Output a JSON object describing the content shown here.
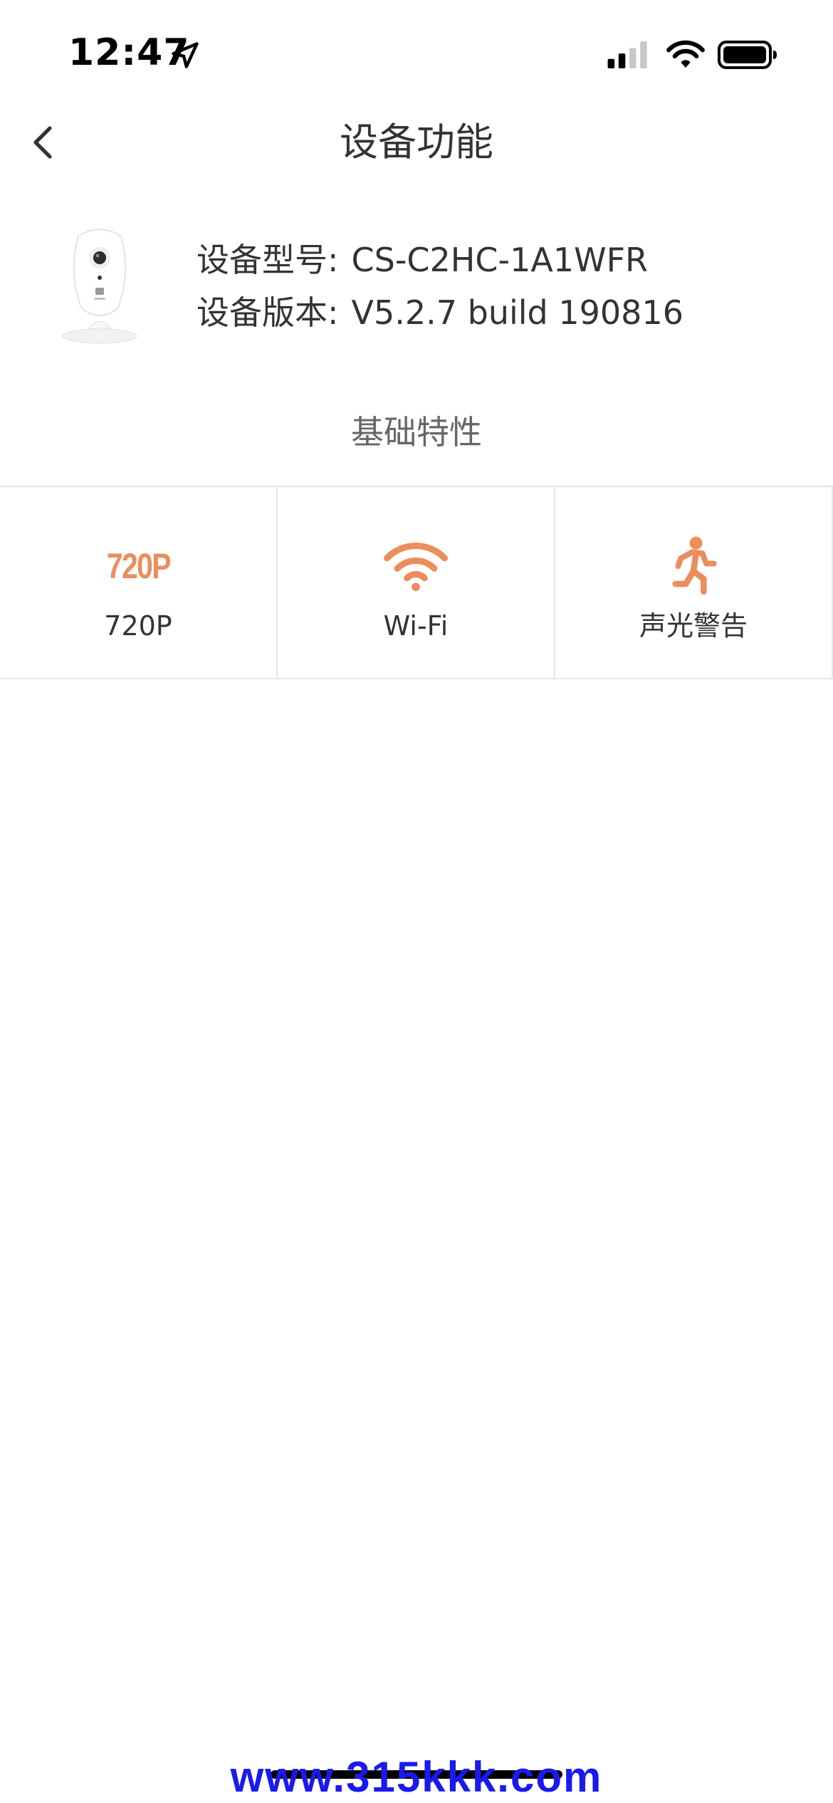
{
  "status_bar": {
    "time": "12:47",
    "icons": [
      "location-arrow-icon",
      "cellular-signal-icon",
      "wifi-icon",
      "battery-icon"
    ]
  },
  "nav": {
    "back_icon": "chevron-left-icon",
    "title": "设备功能"
  },
  "device": {
    "image_icon": "camera-device-icon",
    "model_label": "设备型号:",
    "model_value": "CS-C2HC-1A1WFR",
    "version_label": "设备版本:",
    "version_value": "V5.2.7 build 190816"
  },
  "section": {
    "title": "基础特性"
  },
  "features": [
    {
      "icon": "resolution-720p-icon",
      "icon_text": "720P",
      "label": "720P"
    },
    {
      "icon": "wifi-icon",
      "label": "Wi-Fi"
    },
    {
      "icon": "running-person-icon",
      "label": "声光警告"
    }
  ],
  "watermark": "www.315kkk.com",
  "colors": {
    "accent": "#ec8d5c",
    "text": "#333333",
    "muted": "#666666",
    "divider": "#e6e6e6",
    "watermark": "#1a1aee"
  }
}
